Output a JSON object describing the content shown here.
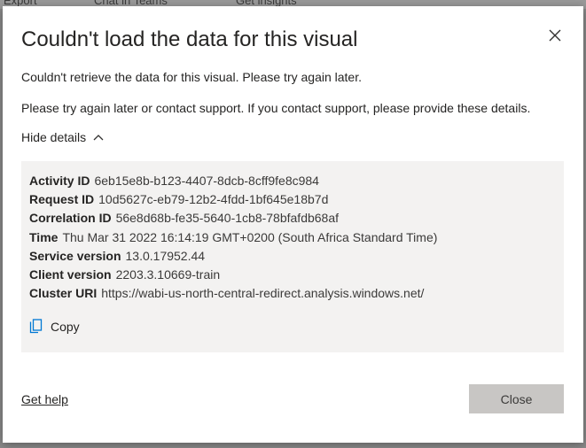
{
  "dialog": {
    "title": "Couldn't load the data for this visual",
    "message_primary": "Couldn't retrieve the data for this visual. Please try again later.",
    "message_secondary": "Please try again later or contact support. If you contact support, please provide these details.",
    "toggle_label": "Hide details",
    "details": [
      {
        "key": "Activity ID",
        "value": "6eb15e8b-b123-4407-8dcb-8cff9fe8c984"
      },
      {
        "key": "Request ID",
        "value": "10d5627c-eb79-12b2-4fdd-1bf645e18b7d"
      },
      {
        "key": "Correlation ID",
        "value": "56e8d68b-fe35-5640-1cb8-78bfafdb68af"
      },
      {
        "key": "Time",
        "value": "Thu Mar 31 2022 16:14:19 GMT+0200 (South Africa Standard Time)"
      },
      {
        "key": "Service version",
        "value": "13.0.17952.44"
      },
      {
        "key": "Client version",
        "value": "2203.3.10669-train"
      },
      {
        "key": "Cluster URI",
        "value": "https://wabi-us-north-central-redirect.analysis.windows.net/"
      }
    ],
    "copy_label": "Copy",
    "get_help_label": "Get help",
    "close_label": "Close"
  },
  "backdrop": {
    "items": [
      "Export",
      "Chat in Teams",
      "Get insights"
    ]
  },
  "icons": {
    "close": "close-icon",
    "chevron": "chevron-up-icon",
    "copy": "copy-icon"
  },
  "colors": {
    "accent": "#0078d4",
    "close_button_bg": "#c8c6c4",
    "details_bg": "#f3f2f1"
  }
}
